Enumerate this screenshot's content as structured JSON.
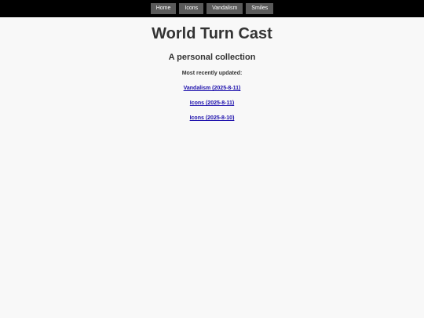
{
  "nav": {
    "items": [
      {
        "label": "Home"
      },
      {
        "label": "Icons"
      },
      {
        "label": "Vandalism"
      },
      {
        "label": "Smiles"
      }
    ]
  },
  "main": {
    "title": "World Turn Cast",
    "subtitle": "A personal collection",
    "recent_label": "Most recently updated:",
    "recent_links": [
      {
        "label": "Vandalism (2025-8-11)"
      },
      {
        "label": "Icons (2025-8-11)"
      },
      {
        "label": "Icons (2025-8-10)"
      }
    ]
  },
  "colors": {
    "topbar": "#000000",
    "nav_button": "#5a5a5a",
    "background": "#f8f8f8",
    "link": "#1a0dab"
  }
}
